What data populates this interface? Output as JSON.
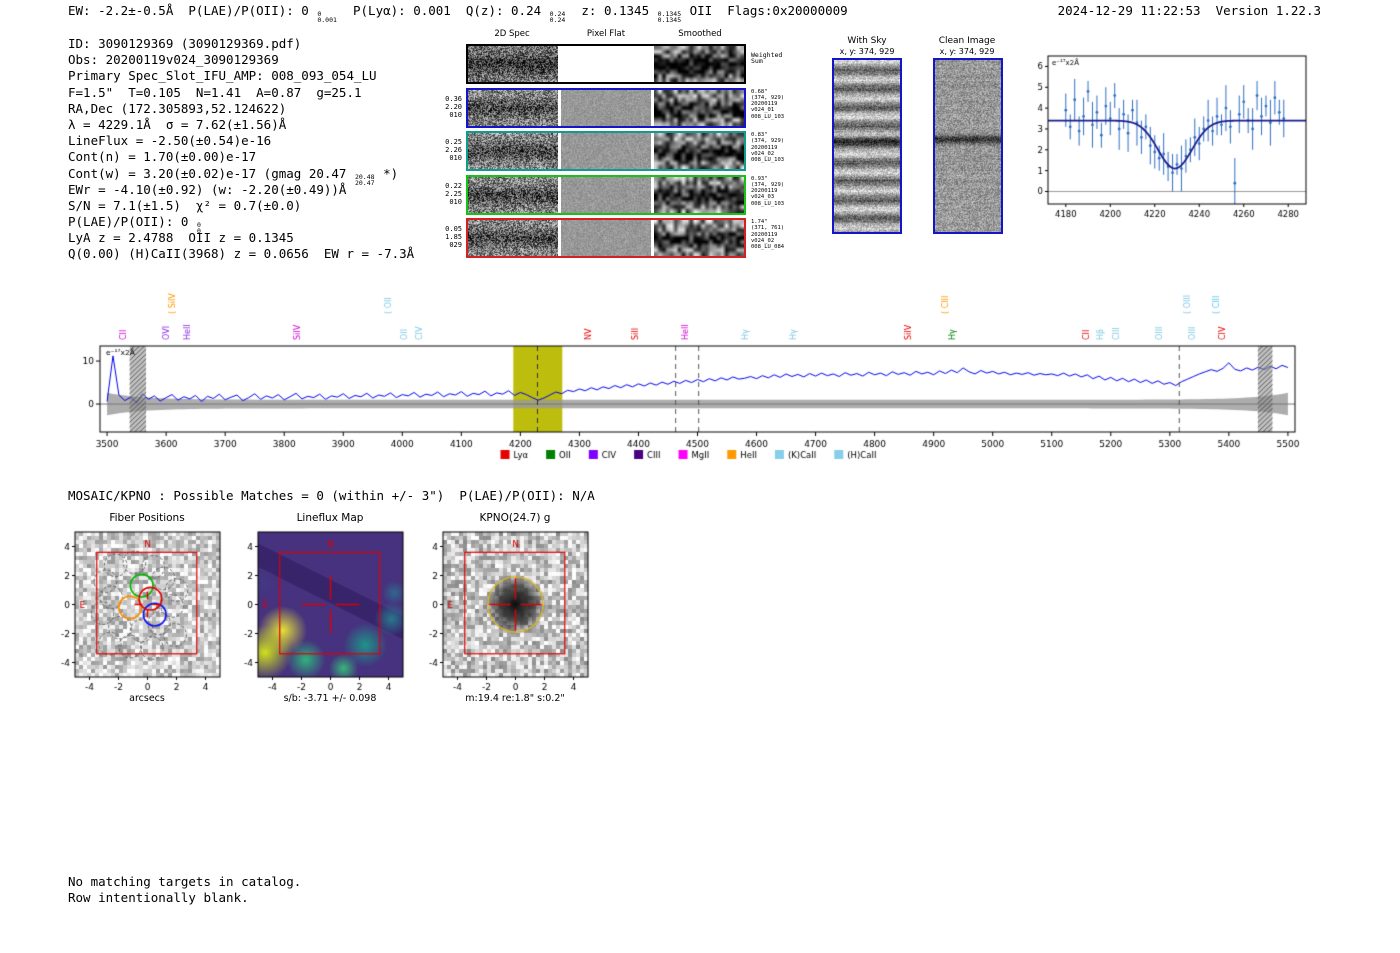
{
  "header": {
    "segments": [
      {
        "t": "EW: -2.2±-0.5Å  P(LAE)/P(OII): 0 "
      },
      {
        "sup": "0",
        "sub": "0.001"
      },
      {
        "t": "  P(Lyα): 0.001  Q(z): 0.24 "
      },
      {
        "sup": "0.24",
        "sub": "0.24"
      },
      {
        "t": "  z: 0.1345 "
      },
      {
        "sup": "0.1345",
        "sub": "0.1345"
      },
      {
        "t": " OII  Flags:0x20000009"
      }
    ],
    "right": "2024-12-29 11:22:53  Version 1.22.3"
  },
  "info_lines": [
    [
      {
        "t": "ID: 3090129369 (3090129369.pdf)"
      }
    ],
    [
      {
        "t": "Obs: 20200119v024_3090129369"
      }
    ],
    [
      {
        "t": "Primary Spec_Slot_IFU_AMP: 008_093_054_LU"
      }
    ],
    [
      {
        "t": "F=1.5\"  T=0.105  N=1.41  A=0.87  g=25.1"
      }
    ],
    [
      {
        "t": "RA,Dec (172.305893,52.124622)"
      }
    ],
    [
      {
        "t": "λ = 4229.1Å  σ = 7.62(±1.56)Å"
      }
    ],
    [
      {
        "t": "LineFlux = -2.50(±0.54)e-16"
      }
    ],
    [
      {
        "t": "Cont(n) = 1.70(±0.00)e-17"
      }
    ],
    [
      {
        "t": "Cont(w) = 3.20(±0.02)e-17 (gmag 20.47 "
      },
      {
        "sup": "20.48",
        "sub": "20.47"
      },
      {
        "t": " *)"
      }
    ],
    [
      {
        "t": "EWr = -4.10(±0.92) (w: -2.20(±0.49))Å"
      }
    ],
    [
      {
        "t": "S/N = 7.1(±1.5)  χ² = 0.7(±0.0)"
      }
    ],
    [
      {
        "t": "P(LAE)/P(OII): 0 "
      },
      {
        "sup": "0",
        "sub": "0"
      }
    ],
    [
      {
        "t": "LyA z = 2.4788  OII z = 0.1345"
      }
    ],
    [
      {
        "t": "Q(0.00) (H)CaII(3968) z = 0.0656  EW r = -7.3Å"
      }
    ]
  ],
  "spec2d": {
    "col_headers": [
      "2D Spec",
      "Pixel Flat",
      "Smoothed"
    ],
    "rows": [
      {
        "border": "#000000",
        "left": [],
        "right": [
          "Weighted",
          "Sum"
        ]
      },
      {
        "border": "#1414c8",
        "left": [
          "0.36",
          "2.20",
          "010"
        ],
        "right": [
          "0.68\"",
          "(374, 929)",
          "20200119",
          "v024_01",
          "008_LU_103"
        ]
      },
      {
        "border": "#0f9b8e",
        "left": [
          "0.25",
          "2.26",
          "010"
        ],
        "right": [
          "0.83\"",
          "(374, 929)",
          "20200119",
          "v024_02",
          "008_LU_103"
        ]
      },
      {
        "border": "#17c217",
        "left": [
          "0.22",
          "2.25",
          "010"
        ],
        "right": [
          "0.93\"",
          "(374, 929)",
          "20200119",
          "v024_03",
          "008_LU_103"
        ]
      },
      {
        "border": "#d42020",
        "left": [
          "0.05",
          "1.85",
          "029"
        ],
        "right": [
          "1.74\"",
          "(371, 761)",
          "20200119",
          "v024_02",
          "008_LU_084"
        ]
      }
    ]
  },
  "sky_panels": [
    {
      "title": "With Sky",
      "subtitle": "x, y: 374, 929"
    },
    {
      "title": "Clean Image",
      "subtitle": "x, y: 374, 929"
    }
  ],
  "mosaic_line": "MOSAIC/KPNO : Possible Matches = 0 (within +/- 3\")  P(LAE)/P(OII): N/A",
  "footer_lines": [
    "No matching targets in catalog.",
    "Row intentionally blank."
  ],
  "chart_data": [
    {
      "name": "emission-line-fit-zoom",
      "type": "scatter",
      "ylabel": "e⁻¹⁷x2Å",
      "xlim": [
        4172,
        4288
      ],
      "ylim": [
        -0.6,
        6.5
      ],
      "xticks": [
        4180,
        4200,
        4220,
        4240,
        4260,
        4280
      ],
      "yticks": [
        0,
        1,
        2,
        3,
        4,
        5,
        6
      ],
      "x": [
        4180,
        4182,
        4184,
        4186,
        4188,
        4190,
        4192,
        4194,
        4196,
        4198,
        4200,
        4202,
        4204,
        4206,
        4208,
        4210,
        4212,
        4214,
        4216,
        4218,
        4220,
        4222,
        4224,
        4226,
        4228,
        4230,
        4232,
        4234,
        4236,
        4238,
        4240,
        4242,
        4244,
        4246,
        4248,
        4250,
        4252,
        4254,
        4256,
        4258,
        4260,
        4262,
        4264,
        4266,
        4268,
        4270,
        4272,
        4274,
        4276,
        4278
      ],
      "y": [
        3.9,
        3.1,
        4.4,
        2.9,
        3.6,
        4.8,
        3.2,
        3.8,
        2.7,
        4.1,
        3.5,
        4.6,
        3.0,
        3.7,
        2.8,
        3.9,
        3.3,
        2.6,
        3.1,
        2.2,
        1.9,
        1.6,
        1.8,
        1.2,
        0.9,
        1.3,
        1.1,
        1.7,
        2.0,
        2.6,
        2.3,
        3.0,
        3.4,
        2.9,
        3.6,
        3.2,
        4.0,
        3.1,
        0.4,
        3.7,
        4.3,
        3.4,
        3.0,
        4.6,
        3.6,
        4.1,
        3.3,
        4.5,
        3.8,
        3.5
      ],
      "yerr": [
        0.8,
        0.6,
        1.0,
        0.7,
        0.9,
        0.5,
        1.1,
        0.8,
        0.6,
        0.9,
        0.8,
        0.6,
        1.0,
        0.7,
        0.9,
        0.5,
        1.1,
        0.8,
        0.6,
        0.9,
        0.8,
        0.6,
        1.0,
        0.7,
        0.9,
        0.5,
        1.1,
        0.8,
        0.6,
        0.9,
        0.8,
        0.6,
        1.0,
        0.7,
        0.9,
        0.5,
        1.1,
        0.8,
        1.2,
        0.9,
        0.8,
        0.6,
        1.0,
        0.7,
        0.9,
        0.5,
        1.1,
        0.8,
        0.6,
        0.9
      ],
      "fit": {
        "continuum": 3.4,
        "depth": 2.3,
        "center": 4229.1,
        "sigma": 7.62
      },
      "point_color": "#2f6fc4",
      "fit_color": "#1a1a8c"
    },
    {
      "name": "full-spectrum",
      "type": "line",
      "ylabel": "e⁻¹⁷x2Å",
      "x_start": 3500,
      "x_step": 10,
      "flux": [
        0.6,
        11.2,
        2.1,
        0.8,
        1.6,
        0.3,
        2.4,
        1.1,
        1.9,
        0.7,
        1.5,
        2.2,
        0.9,
        1.7,
        1.2,
        2.0,
        0.6,
        1.8,
        1.3,
        2.3,
        1.0,
        1.6,
        2.1,
        0.8,
        1.5,
        2.4,
        1.1,
        1.9,
        1.4,
        2.2,
        1.0,
        1.7,
        2.5,
        1.2,
        1.8,
        1.5,
        2.3,
        1.1,
        1.9,
        1.6,
        2.4,
        1.3,
        2.0,
        1.7,
        2.5,
        1.4,
        2.1,
        1.8,
        2.6,
        1.5,
        2.2,
        1.9,
        2.7,
        1.6,
        2.3,
        2.0,
        2.8,
        1.7,
        2.4,
        2.1,
        2.9,
        1.8,
        2.5,
        2.2,
        3.0,
        1.9,
        2.6,
        2.3,
        3.1,
        2.0,
        2.7,
        2.2,
        1.5,
        0.9,
        1.4,
        2.1,
        2.8,
        2.4,
        3.2,
        2.9,
        3.5,
        3.1,
        3.8,
        3.3,
        4.0,
        3.6,
        4.3,
        3.8,
        4.5,
        4.0,
        4.7,
        4.2,
        4.9,
        4.4,
        5.1,
        4.6,
        5.3,
        4.8,
        5.5,
        5.0,
        5.7,
        5.2,
        5.9,
        5.4,
        6.1,
        5.6,
        6.3,
        5.8,
        6.0,
        6.4,
        5.9,
        6.6,
        6.1,
        6.8,
        6.2,
        7.0,
        6.4,
        6.9,
        6.3,
        7.1,
        6.5,
        7.2,
        6.6,
        7.0,
        6.4,
        7.3,
        6.7,
        7.1,
        6.5,
        7.4,
        6.8,
        7.2,
        6.6,
        7.5,
        6.9,
        7.3,
        6.7,
        7.6,
        7.0,
        7.4,
        6.8,
        7.7,
        7.1,
        7.9,
        7.3,
        8.4,
        7.5,
        7.0,
        7.8,
        7.2,
        7.6,
        7.0,
        7.4,
        6.8,
        7.2,
        6.9,
        7.3,
        6.7,
        7.1,
        6.8,
        7.0,
        6.6,
        7.2,
        6.5,
        7.0,
        6.3,
        6.8,
        5.9,
        6.5,
        5.6,
        6.2,
        5.4,
        6.0,
        5.2,
        5.8,
        5.0,
        5.6,
        4.8,
        5.4,
        4.6,
        5.0,
        4.3,
        5.2,
        5.8,
        6.4,
        7.0,
        7.5,
        8.0,
        7.6,
        8.3,
        9.6,
        8.1,
        7.7,
        8.4,
        7.9,
        8.6,
        8.0,
        8.8,
        8.2,
        9.0,
        8.5
      ],
      "xlim": [
        3488,
        5512
      ],
      "ylim": [
        -6.5,
        13.5
      ],
      "xticks": [
        3500,
        3600,
        3700,
        3800,
        3900,
        4000,
        4100,
        4200,
        4300,
        4400,
        4500,
        4600,
        4700,
        4800,
        4900,
        5000,
        5100,
        5200,
        5300,
        5400,
        5500
      ],
      "yticks": [
        0,
        10
      ],
      "line_color": "#0000ee",
      "noise_band": {
        "color": "#999999",
        "half": 1.0,
        "edge_extra": 1.6
      },
      "highlight_band": {
        "x0": 4188,
        "x1": 4271,
        "color": "#bdbd0e"
      },
      "hatch_bands": [
        [
          3538,
          3566
        ],
        [
          5449,
          5474
        ]
      ],
      "dashed_lines": [
        {
          "x": 4229,
          "color": "#333333"
        },
        {
          "x": 4463,
          "color": "#555555"
        },
        {
          "x": 4502,
          "color": "#555555"
        },
        {
          "x": 5316,
          "color": "#555555"
        }
      ],
      "line_labels": [
        {
          "text": "CII",
          "color": "#d400d4",
          "wl": 3529,
          "hi": false
        },
        {
          "text": "OVI",
          "color": "#8a2be2",
          "wl": 3601,
          "hi": false
        },
        {
          "text": "( SiIV",
          "color": "#ff9900",
          "wl": 3612,
          "hi": true
        },
        {
          "text": "HeII",
          "color": "#8a2be2",
          "wl": 3637,
          "hi": false
        },
        {
          "text": "SiIV",
          "color": "#d400d4",
          "wl": 3824,
          "hi": false
        },
        {
          "text": "( OII",
          "color": "#7ec8e3",
          "wl": 3978,
          "hi": true
        },
        {
          "text": "OII",
          "color": "#7ec8e3",
          "wl": 4004,
          "hi": false
        },
        {
          "text": "CIV",
          "color": "#7ec8e3",
          "wl": 4030,
          "hi": false
        },
        {
          "text": "NV",
          "color": "#e60000",
          "wl": 4316,
          "hi": false
        },
        {
          "text": "SiII",
          "color": "#e60000",
          "wl": 4395,
          "hi": false
        },
        {
          "text": "HeII",
          "color": "#d400d4",
          "wl": 4480,
          "hi": false
        },
        {
          "text": "Hγ",
          "color": "#7ec8e3",
          "wl": 4582,
          "hi": false
        },
        {
          "text": "Hγ",
          "color": "#7ec8e3",
          "wl": 4664,
          "hi": false
        },
        {
          "text": "SiIV",
          "color": "#e60000",
          "wl": 4858,
          "hi": false
        },
        {
          "text": "( CIII",
          "color": "#ff9900",
          "wl": 4921,
          "hi": true
        },
        {
          "text": "Hγ",
          "color": "#008000",
          "wl": 4932,
          "hi": false
        },
        {
          "text": "CII",
          "color": "#e60000",
          "wl": 5160,
          "hi": false
        },
        {
          "text": "Hβ",
          "color": "#7ec8e3",
          "wl": 5184,
          "hi": false
        },
        {
          "text": "CIII",
          "color": "#7ec8e3",
          "wl": 5210,
          "hi": false
        },
        {
          "text": "OIII",
          "color": "#7ec8e3",
          "wl": 5283,
          "hi": false
        },
        {
          "text": "( OIII",
          "color": "#7ec8e3",
          "wl": 5330,
          "hi": true
        },
        {
          "text": "OIII",
          "color": "#7ec8e3",
          "wl": 5340,
          "hi": false
        },
        {
          "text": "( CIII",
          "color": "#56c8f0",
          "wl": 5380,
          "hi": true
        },
        {
          "text": "CIV",
          "color": "#e60000",
          "wl": 5390,
          "hi": false
        }
      ],
      "legend": [
        {
          "label": "Lyα",
          "color": "#e60000"
        },
        {
          "label": "OII",
          "color": "#008000"
        },
        {
          "label": "CIV",
          "color": "#8000ff"
        },
        {
          "label": "CIII",
          "color": "#4b0082"
        },
        {
          "label": "MgII",
          "color": "#ff00ff"
        },
        {
          "label": "HeII",
          "color": "#ff9900"
        },
        {
          "label": "(K)CaII",
          "color": "#87ceeb"
        },
        {
          "label": "(H)CaII",
          "color": "#87ceeb"
        }
      ]
    },
    {
      "name": "fiber-positions-cutout",
      "type": "image-cutout",
      "title": "Fiber Positions",
      "xlabel": "arcsecs",
      "xlim": [
        -5,
        5
      ],
      "ylim": [
        -5,
        5
      ],
      "xticks": [
        -4,
        -2,
        0,
        2,
        4
      ],
      "yticks": [
        -4,
        -2,
        0,
        2,
        4
      ],
      "compass": {
        "n": "N",
        "e": "E"
      },
      "square": {
        "x0": -3.5,
        "y0": -3.4,
        "x1": 3.4,
        "y1": 3.6,
        "color": "#e00000"
      },
      "crosshair": {
        "x": 0,
        "y": 0,
        "size": 0.9,
        "color": "#e00000"
      },
      "fiber_radius": 0.78,
      "dashed_fibers": [
        [
          -2.2,
          2.7
        ],
        [
          -0.9,
          2.9
        ],
        [
          0.4,
          2.6
        ],
        [
          -2.9,
          1.6
        ],
        [
          1.1,
          1.8
        ],
        [
          2.0,
          1.0
        ],
        [
          -2.5,
          0.5
        ],
        [
          -3.1,
          -0.6
        ],
        [
          1.7,
          -0.1
        ],
        [
          -1.9,
          -1.6
        ],
        [
          0.8,
          -1.3
        ],
        [
          1.9,
          -2.1
        ],
        [
          -2.6,
          -2.7
        ],
        [
          -1.2,
          -2.9
        ],
        [
          0.3,
          -3.0
        ],
        [
          -0.4,
          -1.8
        ]
      ],
      "colored_fibers": [
        {
          "x": -0.4,
          "y": 1.3,
          "color": "#00b800"
        },
        {
          "x": -1.2,
          "y": -0.2,
          "color": "#ff8c00"
        },
        {
          "x": 0.5,
          "y": -0.7,
          "color": "#1010ee"
        },
        {
          "x": 0.2,
          "y": 0.4,
          "color": "#e00000"
        }
      ]
    },
    {
      "name": "lineflux-map-cutout",
      "type": "heatmap",
      "title": "Lineflux Map",
      "xlabel": "s/b: -3.71 +/- 0.098",
      "xlim": [
        -5,
        5
      ],
      "ylim": [
        -5,
        5
      ],
      "xticks": [
        -4,
        -2,
        0,
        2,
        4
      ],
      "yticks": [
        -4,
        -2,
        0,
        2,
        4
      ],
      "compass": {
        "n": "N",
        "e": "E"
      },
      "square": {
        "x0": -3.5,
        "y0": -3.4,
        "x1": 3.4,
        "y1": 3.6,
        "color": "#e00000"
      },
      "crosshair": {
        "x": 0,
        "y": 0,
        "size": 2.0,
        "color": "#e00000"
      },
      "background": "#46327e",
      "dark_band": {
        "poly": [
          [
            -5,
            4.2
          ],
          [
            5,
            -0.8
          ],
          [
            5,
            -2.4
          ],
          [
            -5,
            2.6
          ]
        ],
        "color": "#38246b"
      },
      "blobs": [
        {
          "x": -3.3,
          "y": -1.8,
          "r": 1.0,
          "color": "#e8e337"
        },
        {
          "x": -4.5,
          "y": -3.3,
          "r": 1.1,
          "color": "#d0e11c"
        },
        {
          "x": -1.7,
          "y": -3.8,
          "r": 0.8,
          "color": "#2fb47c"
        },
        {
          "x": 2.4,
          "y": -2.8,
          "r": 0.9,
          "color": "#1f948a"
        },
        {
          "x": 4.2,
          "y": -1.0,
          "r": 0.7,
          "color": "#2a788e"
        },
        {
          "x": 0.9,
          "y": -4.4,
          "r": 0.6,
          "color": "#35b779"
        },
        {
          "x": 4.4,
          "y": 0.8,
          "r": 0.5,
          "color": "#31688e"
        },
        {
          "x": -4.6,
          "y": 1.5,
          "r": 0.6,
          "color": "#443983"
        }
      ]
    },
    {
      "name": "kpno-g-cutout",
      "type": "image-cutout",
      "title": "KPNO(24.7) g",
      "xlabel": "m:19.4 re:1.8\" s:0.2\"",
      "xlim": [
        -5,
        5
      ],
      "ylim": [
        -5,
        5
      ],
      "xticks": [
        -4,
        -2,
        0,
        2,
        4
      ],
      "yticks": [
        -4,
        -2,
        0,
        2,
        4
      ],
      "compass": {
        "n": "N",
        "e": "E"
      },
      "square": {
        "x0": -3.5,
        "y0": -3.4,
        "x1": 3.4,
        "y1": 3.6,
        "color": "#e00000"
      },
      "crosshair": {
        "x": 0,
        "y": 0,
        "size": 1.8,
        "color": "#e00000"
      },
      "galaxy_blob": {
        "x": 0,
        "y": 0,
        "r": 1.5
      },
      "aperture_circle": {
        "x": 0,
        "y": 0,
        "r": 1.9,
        "color": "#d9b520"
      }
    }
  ]
}
